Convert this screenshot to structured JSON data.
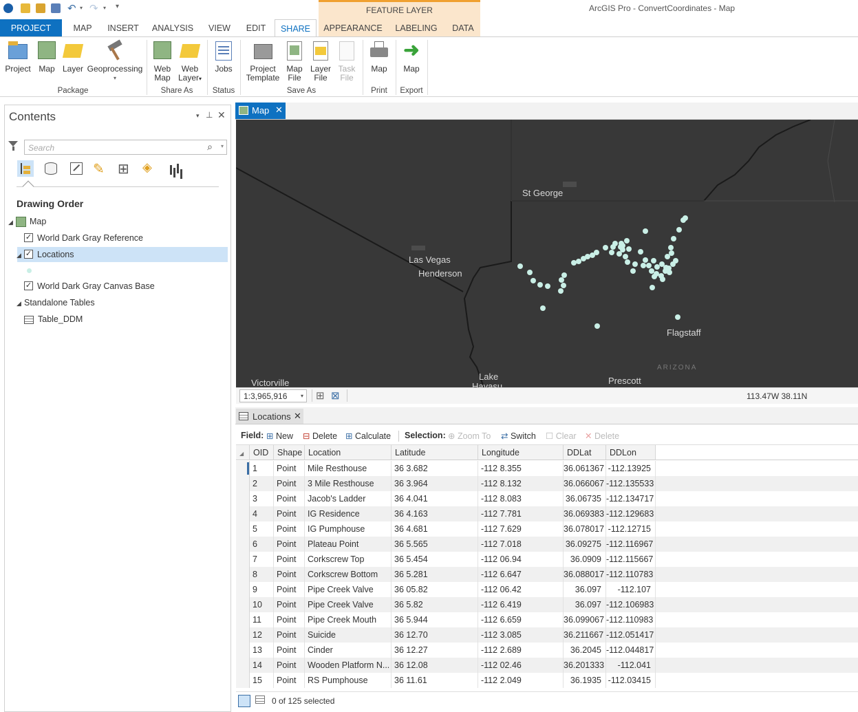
{
  "app": {
    "title": "ArcGIS Pro - ConvertCoordinates - Map",
    "context_tab_group": "FEATURE LAYER"
  },
  "tabs": [
    "PROJECT",
    "MAP",
    "INSERT",
    "ANALYSIS",
    "VIEW",
    "EDIT",
    "SHARE",
    "APPEARANCE",
    "LABELING",
    "DATA"
  ],
  "ribbon": {
    "project": "Project",
    "map": "Map",
    "layer": "Layer",
    "geoprocessing": "Geoprocessing",
    "web_map_1": "Web",
    "web_map_2": "Map",
    "web_layer_1": "Web",
    "web_layer_2": "Layer",
    "jobs": "Jobs",
    "project_template_1": "Project",
    "project_template_2": "Template",
    "map_file_1": "Map",
    "map_file_2": "File",
    "layer_file_1": "Layer",
    "layer_file_2": "File",
    "task_file_1": "Task",
    "task_file_2": "File",
    "print_map": "Map",
    "export_map": "Map",
    "groups": {
      "package": "Package",
      "share_as": "Share As",
      "status": "Status",
      "save_as": "Save As",
      "print": "Print",
      "export": "Export"
    }
  },
  "contents": {
    "title": "Contents",
    "search_placeholder": "Search",
    "heading": "Drawing Order",
    "map": "Map",
    "layers": [
      "World Dark Gray Reference",
      "Locations",
      "World Dark Gray Canvas Base"
    ],
    "standalone": "Standalone Tables",
    "table": "Table_DDM"
  },
  "map": {
    "tab": "Map",
    "labels": {
      "st_george": "St George",
      "las_vegas": "Las Vegas",
      "henderson": "Henderson",
      "flagstaff": "Flagstaff",
      "arizona": "ARIZONA",
      "lake": "Lake",
      "havasu": "Havasu",
      "prescott": "Prescott",
      "victorville": "Victorville"
    },
    "scale": "1:3,965,916",
    "coords": "113.47W 38.11N",
    "colors": {
      "background": "#383838",
      "points": "#c9efe6"
    }
  },
  "table": {
    "tab": "Locations",
    "field_label": "Field:",
    "new": "New",
    "delete": "Delete",
    "calculate": "Calculate",
    "selection_label": "Selection:",
    "zoom_to": "Zoom To",
    "switch": "Switch",
    "clear": "Clear",
    "delete_sel": "Delete",
    "columns": [
      "OID",
      "Shape",
      "Location",
      "Latitude",
      "Longitude",
      "DDLat",
      "DDLon"
    ],
    "rows": [
      [
        "1",
        "Point",
        "Mile Resthouse",
        "36 3.682",
        "-112 8.355",
        "36.061367",
        "-112.13925"
      ],
      [
        "2",
        "Point",
        "3 Mile Resthouse",
        "36 3.964",
        "-112 8.132",
        "36.066067",
        "-112.135533"
      ],
      [
        "3",
        "Point",
        "Jacob's Ladder",
        "36 4.041",
        "-112 8.083",
        "36.06735",
        "-112.134717"
      ],
      [
        "4",
        "Point",
        "IG Residence",
        "36 4.163",
        "-112 7.781",
        "36.069383",
        "-112.129683"
      ],
      [
        "5",
        "Point",
        "IG Pumphouse",
        "36 4.681",
        "-112 7.629",
        "36.078017",
        "-112.12715"
      ],
      [
        "6",
        "Point",
        "Plateau Point",
        "36 5.565",
        "-112 7.018",
        "36.09275",
        "-112.116967"
      ],
      [
        "7",
        "Point",
        "Corkscrew Top",
        "36 5.454",
        "-112 06.94",
        "36.0909",
        "-112.115667"
      ],
      [
        "8",
        "Point",
        "Corkscrew Bottom",
        "36 5.281",
        "-112 6.647",
        "36.088017",
        "-112.110783"
      ],
      [
        "9",
        "Point",
        "Pipe Creek Valve",
        "36 05.82",
        "-112 06.42",
        "36.097",
        "-112.107"
      ],
      [
        "10",
        "Point",
        "Pipe Creek Valve",
        "36 5.82",
        "-112 6.419",
        "36.097",
        "-112.106983"
      ],
      [
        "11",
        "Point",
        "Pipe Creek Mouth",
        "36 5.944",
        "-112 6.659",
        "36.099067",
        "-112.110983"
      ],
      [
        "12",
        "Point",
        "Suicide",
        "36 12.70",
        "-112 3.085",
        "36.211667",
        "-112.051417"
      ],
      [
        "13",
        "Point",
        "Cinder",
        "36 12.27",
        "-112 2.689",
        "36.2045",
        "-112.044817"
      ],
      [
        "14",
        "Point",
        "Wooden Platform N...",
        "36 12.08",
        "-112 02.46",
        "36.201333",
        "-112.041"
      ],
      [
        "15",
        "Point",
        "RS Pumphouse",
        "36 11.61",
        "-112 2.049",
        "36.1935",
        "-112.03415"
      ]
    ],
    "status": "0 of 125 selected"
  }
}
